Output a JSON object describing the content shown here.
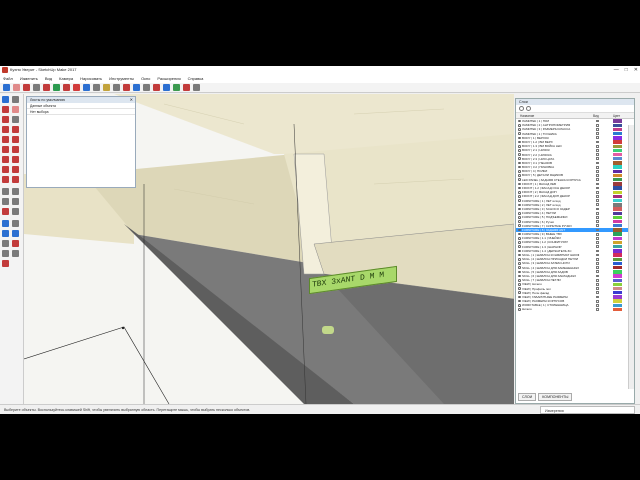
{
  "window": {
    "title": "Кухня Уверит - SketchUp Make 2017",
    "min": "—",
    "max": "□",
    "close": "✕"
  },
  "menu": [
    "Файл",
    "Изменить",
    "Вид",
    "Камера",
    "Нарисовать",
    "Инструменты",
    "Окно",
    "Расширения",
    "Справка"
  ],
  "entity_info": {
    "title": "Листы по умолчанию",
    "row1": "Данные объекта",
    "row2": "Нет выбора",
    "close": "✕"
  },
  "tag_label": "TBX 3xANT D M M",
  "layers": {
    "title": "Слои",
    "col_name": "Название",
    "col_visible": "Вид",
    "col_color": "Цвет",
    "rows": [
      {
        "name": "ЛАМИТЕК | 1 | ПОЛ",
        "color": "#7a3b9a",
        "sel": false
      },
      {
        "name": "ЛАМИТЕК | 2 | АНТРОПОМЕТРИЯ",
        "color": "#3b4f9a",
        "sel": false
      },
      {
        "name": "ЛАМИТЕК | 3 | РАЗМЕРЫ КЛАССА",
        "color": "#c23b8a",
        "sel": false
      },
      {
        "name": "ЛАМИТЕК | 1 | ТОЧНИКА",
        "color": "#2b7bd1",
        "sel": false
      },
      {
        "name": "BODY | 1 | ВЕРХОК",
        "color": "#8a2be2",
        "sel": false
      },
      {
        "name": "BODY | 1.2 | BM ВЕРХ",
        "color": "#d13b3b",
        "sel": false
      },
      {
        "name": "BODY | 1.3 | BM ВОЙКА LED",
        "color": "#9a9a3b",
        "sel": false
      },
      {
        "name": "BODY | 2.1 | НИЗОК",
        "color": "#3bd17a",
        "sel": false
      },
      {
        "name": "BODY | 2.2 | НИЗОКА",
        "color": "#e35da3",
        "sel": false
      },
      {
        "name": "BODY | 2.3 | НИЗ ЦАТА",
        "color": "#5a8ad1",
        "sel": false
      },
      {
        "name": "BODY | 3.1 | ПЕНЗОВ",
        "color": "#a35d2b",
        "sel": false
      },
      {
        "name": "BODY | 3.2 | ПИНОВКА",
        "color": "#2bd1c2",
        "sel": false
      },
      {
        "name": "BODY | 4 | ПОЛКИ",
        "color": "#5d2ba3",
        "sel": false
      },
      {
        "name": "BODY | 5 | ДЕТАЛИ ЯЩИКОВ",
        "color": "#d18a2b",
        "sel": false
      },
      {
        "name": "LED PANEL | ЗАДНЯЯ СТЕНКА КОРПУСА",
        "color": "#3b9a4f",
        "sel": false
      },
      {
        "name": "FRONT | 1 | ФАСАД ЛЕВ",
        "color": "#9a3b3b",
        "sel": false
      },
      {
        "name": "FRONT | 1.2 | ФАСАД ОСН ДЕКОР",
        "color": "#2b4fa3",
        "sel": false
      },
      {
        "name": "FRONT | 2 | ФАСАД ДОП",
        "color": "#c2d12b",
        "sel": false
      },
      {
        "name": "FRONT | 2.2 | ФАСАД ДОП ДЕКОР",
        "color": "#a32b7a",
        "sel": false
      },
      {
        "name": "FURNITURE | 1 | ЛЕТ исход",
        "color": "#3bd1d1",
        "sel": false
      },
      {
        "name": "FURNITURE | 2 | ЛЕТ исход",
        "color": "#7a7a7a",
        "sel": false
      },
      {
        "name": "FURNITURE | 3 | SCHOCO ЗАДЕР",
        "color": "#d15d5d",
        "sel": false
      },
      {
        "name": "FURNITURE | 4 | ПЕТЛИ",
        "color": "#4f3b9a",
        "sel": false
      },
      {
        "name": "FURNITURE | 5 | ПОДЪЕМНИКИ",
        "color": "#5dd13b",
        "sel": false
      },
      {
        "name": "FURNITURE | 6 | Ручки",
        "color": "#d13ba3",
        "sel": false
      },
      {
        "name": "FURNITURE | 7 | СКРЫТЫЕ РУЧКИ",
        "color": "#3b7ad1",
        "sel": false
      },
      {
        "name": "FURNITURE | 8 | ЗАДНЯЯ ANT",
        "color": "#9a5d2b",
        "sel": true
      },
      {
        "name": "FURNITURE | 9 | ВЫШЕ ТВХ",
        "color": "#2ba35d",
        "sel": false
      },
      {
        "name": "FURNITURE | 1.1 | ЯЧЕЙКИ",
        "color": "#c23bd1",
        "sel": false
      },
      {
        "name": "FURNITURE | 1.2 | КОНФИГУРАТ",
        "color": "#d1a32b",
        "sel": false
      },
      {
        "name": "FURNITURE | 1.3 | ШАРНИР",
        "color": "#3ba3a3",
        "sel": false
      },
      {
        "name": "FURNITURE | 1.4 | ДЕРЖАТЕЛЬ ЗС",
        "color": "#7a2bd1",
        "sel": false
      },
      {
        "name": "SKILL | 1 | ШАБЛОН КОНФИРМАТ ШКОФ",
        "color": "#d12b5d",
        "sel": false
      },
      {
        "name": "SKILL | 2 | ШАБЛОН ПРИСАДКИ ПЕТЛИ",
        "color": "#5d9a3b",
        "sel": false
      },
      {
        "name": "SKILL | 3 | ШАБЛОН ЗАТЕМ НОГИ",
        "color": "#2b5dd1",
        "sel": false
      },
      {
        "name": "SKILL | 4 | ШАБЛОН ДЛЯ ЗАМЕНЕННЫХ",
        "color": "#a32b2b",
        "sel": false
      },
      {
        "name": "SKILL | 5 | ШАБЛОН ДЛЯ ЗАДОВ",
        "color": "#3bd15d",
        "sel": false
      },
      {
        "name": "SKILL | 6 | ШАБЛОН ДЛЯ ЗАКЛАДНЫХ",
        "color": "#d13bd1",
        "sel": false
      },
      {
        "name": "SKILL | 7 | ШАБЛОН ПЕТЛИ",
        "color": "#5d5dd1",
        "sel": false
      },
      {
        "name": "VIEW | Ничего",
        "color": "#8ad13b",
        "sel": false
      },
      {
        "name": "VIEW | Профиль пол",
        "color": "#d18a8a",
        "sel": false
      },
      {
        "name": "VIEW | Полн фасад",
        "color": "#3b3bd1",
        "sel": false
      },
      {
        "name": "VIEW | ГАБАРИТНЫЕ РАЗМЕРЫ",
        "color": "#9a3bd1",
        "sel": false
      },
      {
        "name": "VIEW | РАЗМЕРЫ КОРПУСОВ",
        "color": "#d1d13b",
        "sel": false
      },
      {
        "name": "WORKTABLE | 1 | СТОЛЕШНИЦА",
        "color": "#3b9ad1",
        "sel": false
      },
      {
        "name": "Ничего",
        "color": "#e35d3b",
        "sel": false
      }
    ],
    "tab1": "СЛОИ",
    "tab2": "КОМПОНЕНТЫ"
  },
  "status": {
    "text": "Выберите объекты. Воспользуйтесь клавишей Shift, чтобы увеличить выбранную область. Перетащите мышь, чтобы выбрать несколько объектов.",
    "measure_label": "Измерения"
  },
  "colors": {
    "selection": "#3399ff",
    "wood": "#ece6c8",
    "tag": "#a8d86a"
  }
}
